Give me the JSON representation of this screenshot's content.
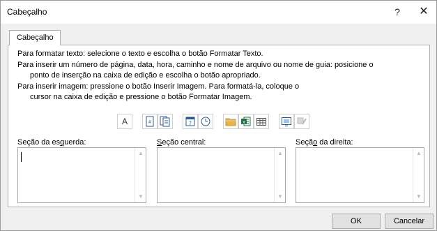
{
  "window": {
    "title": "Cabeçalho",
    "help_label": "?",
    "close_label": "✕"
  },
  "tab": {
    "label": "Cabeçalho"
  },
  "instructions": [
    "Para formatar texto: selecione o texto e escolha o botão Formatar Texto.",
    "Para inserir um número de página, data, hora, caminho e nome de arquivo ou nome de guia: posicione o",
    "ponto de inserção na caixa de edição e escolha o botão apropriado.",
    "Para inserir imagem: pressione o botão Inserir Imagem. Para formatá-la, coloque o",
    "cursor na caixa de edição e pressione o botão Formatar Imagem."
  ],
  "toolbar": {
    "format_text_label": "A",
    "icons": [
      "format-text-icon",
      "page-number-icon",
      "page-count-icon",
      "date-icon",
      "time-icon",
      "file-path-icon",
      "file-name-icon",
      "sheet-name-icon",
      "insert-picture-icon",
      "format-picture-icon"
    ]
  },
  "sections": {
    "left": {
      "label_pre": "Seção da es",
      "label_ul": "q",
      "label_post": "uerda:",
      "value": ""
    },
    "center": {
      "label_pre": "",
      "label_ul": "S",
      "label_post": "eção central:",
      "value": ""
    },
    "right": {
      "label_pre": "Seçã",
      "label_ul": "o",
      "label_post": " da direita:",
      "value": ""
    }
  },
  "buttons": {
    "ok": "OK",
    "cancel": "Cancelar"
  },
  "colors": {
    "excel_green": "#1e7145",
    "folder_yellow": "#e8b34a",
    "icon_blue": "#2b579a"
  }
}
